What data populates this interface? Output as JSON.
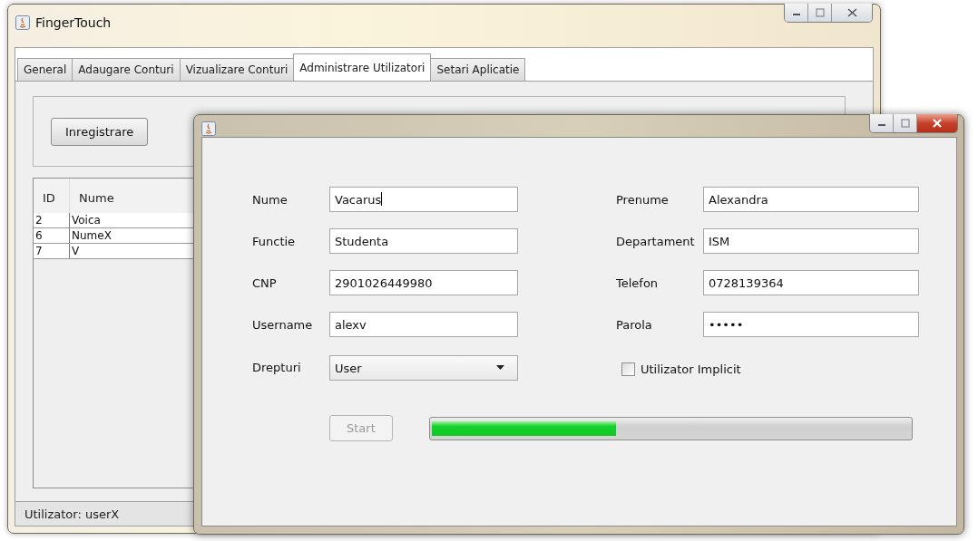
{
  "main_window": {
    "title": "FingerTouch"
  },
  "tabs": [
    {
      "label": "General",
      "selected": false
    },
    {
      "label": "Adaugare Conturi",
      "selected": false
    },
    {
      "label": "Vizualizare Conturi",
      "selected": false
    },
    {
      "label": "Administrare Utilizatori",
      "selected": true
    },
    {
      "label": "Setari Aplicatie",
      "selected": false
    }
  ],
  "toolbar_buttons": [
    "Inregistrare"
  ],
  "table": {
    "columns": [
      "ID",
      "Nume"
    ],
    "rows": [
      [
        "2",
        "Voica"
      ],
      [
        "6",
        "NumeX"
      ],
      [
        "7",
        "V"
      ]
    ]
  },
  "status_bar": "Utilizator: userX",
  "dialog": {
    "fields": [
      {
        "label": "Nume",
        "value": "Vacarus",
        "focused": true
      },
      {
        "label": "Prenume",
        "value": "Alexandra",
        "focused": false
      },
      {
        "label": "Functie",
        "value": "Studenta",
        "focused": false
      },
      {
        "label": "Departament",
        "value": "ISM",
        "focused": false
      },
      {
        "label": "CNP",
        "value": "2901026449980",
        "focused": false
      },
      {
        "label": "Telefon",
        "value": "0728139364",
        "focused": false
      },
      {
        "label": "Username",
        "value": "alexv",
        "focused": false
      },
      {
        "label": "Parola",
        "value": "•••••",
        "focused": false
      }
    ],
    "rights": {
      "label": "Drepturi",
      "value": "User"
    },
    "default_user": {
      "label": "Utilizator Implicit",
      "checked": false
    },
    "start": {
      "label": "Start",
      "disabled": true
    },
    "progress": {
      "level": 0.385
    }
  }
}
